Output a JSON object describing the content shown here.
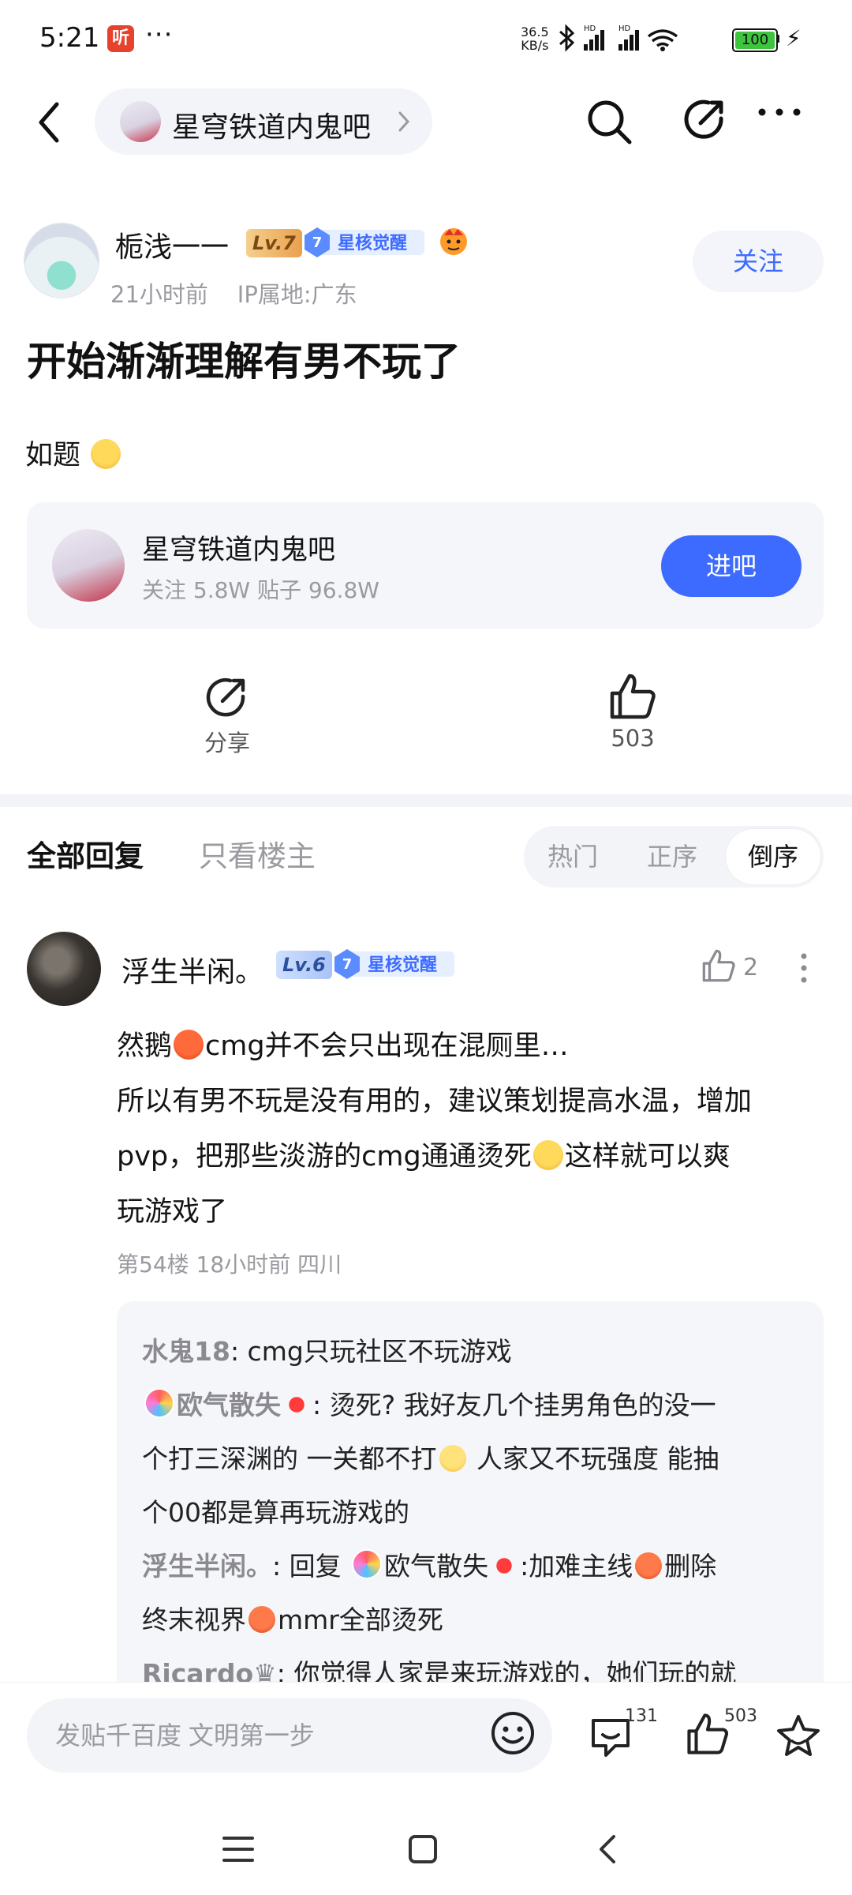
{
  "status_bar": {
    "time": "5:21",
    "app_badge": "听",
    "dots": "···",
    "net_speed_value": "36.5",
    "net_speed_unit": "KB/s",
    "battery": "100"
  },
  "header": {
    "forum_name": "星穹铁道内鬼吧"
  },
  "post": {
    "author": "栀浅一一",
    "level": "Lv.7",
    "badge_level": "7",
    "badge_text": "星核觉醒",
    "time": "21小时前",
    "ip": "IP属地:广东",
    "follow_label": "关注",
    "title": "开始渐渐理解有男不玩了",
    "body": "如题",
    "forum_card": {
      "name": "星穹铁道内鬼吧",
      "stats": "关注 5.8W   贴子 96.8W",
      "enter_label": "进吧"
    },
    "share_label": "分享",
    "like_count": "503"
  },
  "tabs": {
    "all": "全部回复",
    "op_only": "只看楼主",
    "sort": [
      "热门",
      "正序",
      "倒序"
    ],
    "selected_sort": "倒序"
  },
  "reply": {
    "author": "浮生半闲。",
    "level": "Lv.6",
    "badge_level": "7",
    "badge_text": "星核觉醒",
    "like_count": "2",
    "line1_a": "然鹅",
    "line1_b": "cmg并不会只出现在混厕里…",
    "line2": "所以有男不玩是没有用的，建议策划提高水温，增加",
    "line3_a": "pvp，把那些淡游的cmg通通烫死",
    "line3_b": "这样就可以爽",
    "line4": "玩游戏了",
    "meta": "第54楼  18小时前  四川",
    "subreplies": {
      "r1_user": "水鬼18",
      "r1_text": ": cmg只玩社区不玩游戏",
      "r2_user": "欧气散失",
      "r2_text_a": ": 烫死? 我好友几个挂男角色的没一",
      "r2_text_b": "个打三深渊的 一关都不打",
      "r2_text_c": " 人家又不玩强度 能抽",
      "r2_text_d": "个00都是算再玩游戏的",
      "r3_user": "浮生半闲。",
      "r3_text_a": ": 回复",
      "r3_mention": "欧气散失",
      "r3_text_b": ":加难主线",
      "r3_text_c": "删除",
      "r3_text_d": "终末视界",
      "r3_text_e": "mmr全部烫死",
      "r4_user": "Ricardo♛",
      "r4_text": ": 你觉得人家是来玩游戏的，她们玩的就"
    }
  },
  "bottom_bar": {
    "input_placeholder": "发贴千百度 文明第一步",
    "reply_count": "131",
    "like_count": "503"
  },
  "colors": {
    "accent": "#3d6bff",
    "panel": "#f5f6fa",
    "muted_text": "#9a9aa0"
  }
}
